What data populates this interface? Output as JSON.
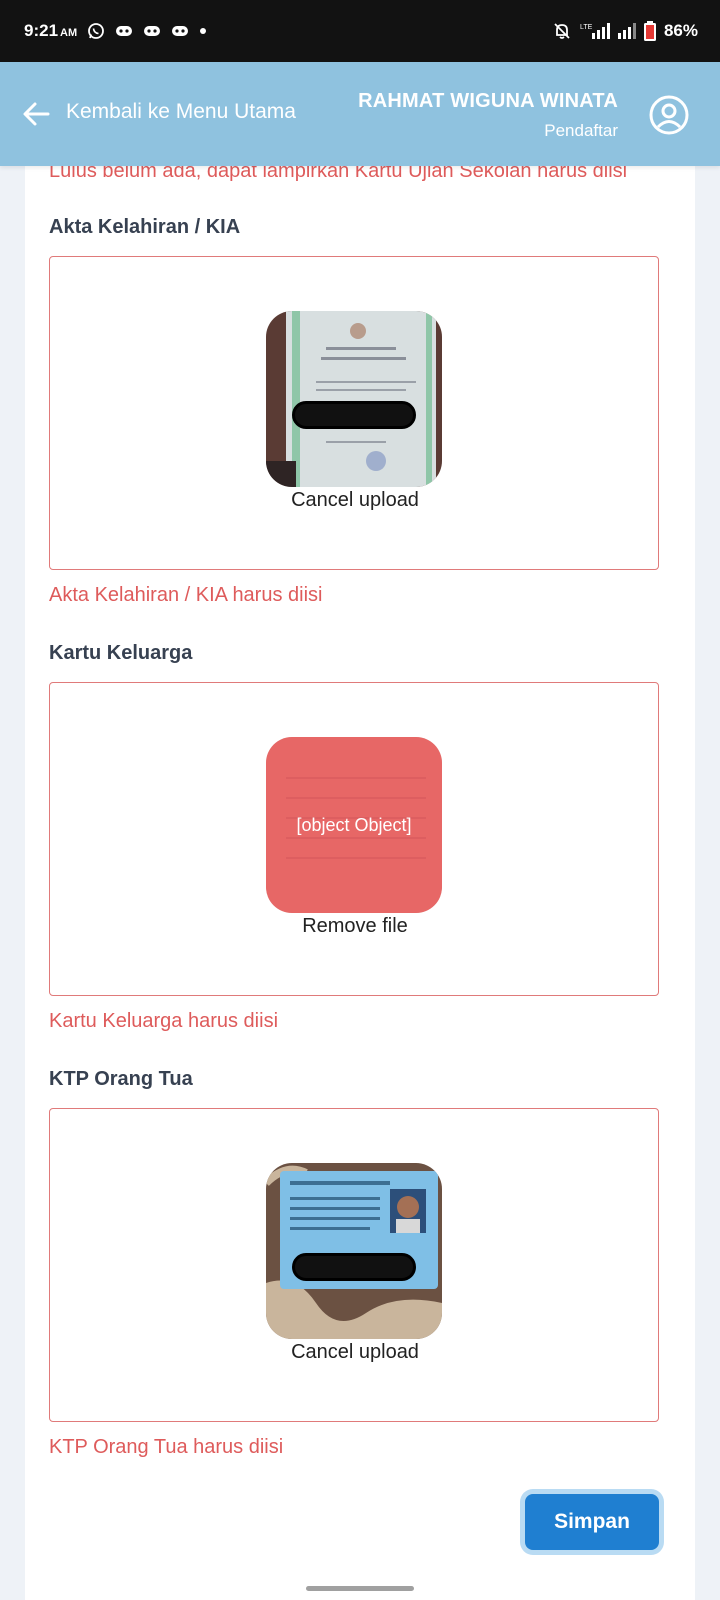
{
  "status_bar": {
    "time": "9:21",
    "ampm": "AM",
    "battery": "86%",
    "network": "LTE",
    "icons": [
      "whatsapp-icon",
      "game-controller-icon",
      "game-controller-icon",
      "game-controller-icon",
      "dot-icon",
      "bell-muted-icon",
      "signal-icon",
      "signal-icon",
      "battery-icon"
    ]
  },
  "header": {
    "back_label": "Kembali ke Menu Utama",
    "user_name": "RAHMAT WIGUNA WINATA",
    "user_role": "Pendaftar",
    "color": "#8fc2df"
  },
  "form": {
    "cut_error": "Lulus belum ada, dapat lampirkan Kartu Ujian Sekolah harus diisi",
    "sections": [
      {
        "title": "Akta Kelahiran / KIA",
        "action": "Cancel upload",
        "error": "Akta Kelahiran / KIA harus diisi"
      },
      {
        "title": "Kartu Keluarga",
        "action": "Remove file",
        "overlay": "[object Object]",
        "error": "Kartu Keluarga harus diisi"
      },
      {
        "title": "KTP Orang Tua",
        "action": "Cancel upload",
        "error": "KTP Orang Tua harus diisi"
      }
    ],
    "submit_label": "Simpan"
  },
  "colors": {
    "error": "#de5b5b",
    "primary": "#1f7fd1",
    "status_bar": "#121212"
  }
}
